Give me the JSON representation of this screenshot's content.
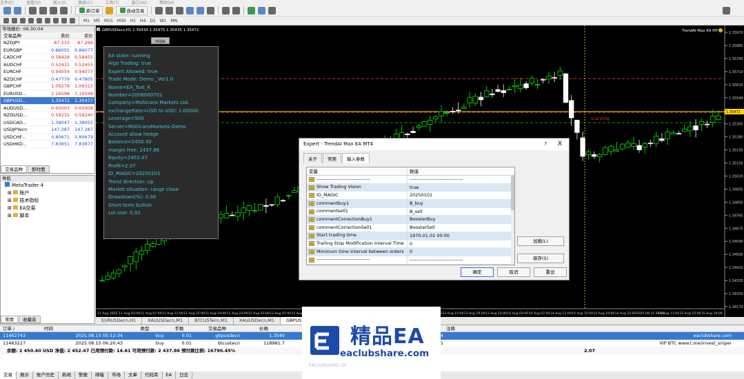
{
  "menu": [
    "文件(F)",
    "查看(V)",
    "插入(I)",
    "图表(C)",
    "工具(T)",
    "窗口(W)",
    "帮助(H)"
  ],
  "toolbar": {
    "new_order": "新订单",
    "auto_trading": "自动交易"
  },
  "timeframes": [
    "M1",
    "M5",
    "M15",
    "M30",
    "H1",
    "H4",
    "D1",
    "W1",
    "MN"
  ],
  "market_watch": {
    "title": "市场报价: 06:30:04",
    "cols": [
      "交易品种",
      "卖价",
      "买价"
    ],
    "rows": [
      {
        "sym": "NZDJPY",
        "bid": "87.233",
        "ask": "87.266",
        "dir": "dn",
        "sel": false
      },
      {
        "sym": "EURGBP",
        "bid": "0.86055",
        "ask": "0.86077",
        "dir": "up",
        "sel": false
      },
      {
        "sym": "CADCHF",
        "bid": "0.58428",
        "ask": "0.58455",
        "dir": "dn",
        "sel": false
      },
      {
        "sym": "AUDCHF",
        "bid": "0.52431",
        "ask": "0.52455",
        "dir": "dn",
        "sel": false
      },
      {
        "sym": "EURCHF",
        "bid": "0.94054",
        "ask": "0.94077",
        "dir": "dn",
        "sel": false
      },
      {
        "sym": "NZDCHF",
        "bid": "0.47779",
        "ask": "0.47805",
        "dir": "up",
        "sel": false
      },
      {
        "sym": "GBPCHF",
        "bid": "1.09278",
        "ask": "1.09315",
        "dir": "dn",
        "sel": false
      },
      {
        "sym": "EURUSD...",
        "bid": "1.16598",
        "ask": "1.16598",
        "dir": "dn",
        "sel": false
      },
      {
        "sym": "GBPUSD...",
        "bid": "1.35472",
        "ask": "1.35477",
        "dir": "up",
        "sel": true
      },
      {
        "sym": "AUDUSD...",
        "bid": "0.65003",
        "ask": "0.65008",
        "dir": "dn",
        "sel": false
      },
      {
        "sym": "NZDUSD...",
        "bid": "0.59235",
        "ask": "0.59240",
        "dir": "dn",
        "sel": false
      },
      {
        "sym": "USDCAD...",
        "bid": "1.38047",
        "ask": "1.38055",
        "dir": "up",
        "sel": false
      },
      {
        "sym": "USDJPYecn",
        "bid": "147.287",
        "ask": "147.287",
        "dir": "up",
        "sel": false
      },
      {
        "sym": "USDCHF...",
        "bid": "0.80671",
        "ask": "0.80679",
        "dir": "up",
        "sel": false
      },
      {
        "sym": "USDHKD...",
        "bid": "7.83851",
        "ask": "7.83877",
        "dir": "up",
        "sel": false
      }
    ],
    "tabs": [
      "交易品种",
      "即时图"
    ]
  },
  "navigator": {
    "title": "导航",
    "root": "MetaTrader 4",
    "items": [
      "账户",
      "技术指标",
      "EA交易",
      "脚本"
    ],
    "tabs": [
      "常用",
      "收藏夹"
    ]
  },
  "chart": {
    "header": "GBPUSDecn,H1  1.35439 1.35475 1.35435 1.35472",
    "ea_name": "TrendAI Max EA MT4",
    "price_label": "1.35472",
    "scanning": "scanning",
    "hide_label": "Hide",
    "prices": [
      "1.35970",
      "1.35885",
      "1.35795",
      "1.35710",
      "1.35625",
      "1.35540",
      "1.35455",
      "1.35365",
      "1.35280",
      "1.35195",
      "1.35105",
      "1.35020",
      "1.34935",
      "1.34850",
      "1.34765",
      "1.34675",
      "1.34590",
      "1.34505",
      "1.34420",
      "1.34335",
      "1.34250",
      "1.34170"
    ],
    "times": [
      "11 Aug 2025",
      "11 Aug 03:00",
      "11 Aug 07:00",
      "11 Aug 11:00",
      "11 Aug 15:00",
      "11 Aug 19:00",
      "11 Aug 23:00",
      "12 Aug 03:00",
      "12 Aug 07:00",
      "12 Aug 11:00",
      "12 Aug 15:00",
      "12 Aug 19:00",
      "12 Aug 23:00",
      "13 Aug 03:00",
      "13 Aug 07:00",
      "13 Aug 11:00",
      "13 Aug 15:00",
      "13 Aug 19:00",
      "13 Aug 23:00",
      "14 Aug 03:00",
      "14 Aug 07:00",
      "14 Aug 11:00",
      "14 Aug 15:00",
      "14 Aug 19:00",
      "14 Aug 23:00",
      "2025.08.15 06:00",
      "15 Aug 11:00",
      "15 Aug 15:00",
      "15 Aug 19:00"
    ],
    "colors": {
      "bull": "#00ff00",
      "bear": "#ffffff",
      "bid_line": "#ffd700",
      "level_line": "#d03030",
      "green_line": "#00a000"
    }
  },
  "info_panel": [
    "EA state: running",
    "Algo Trading: true",
    "Expert Allowed: true",
    "Trade Mode: Demo _Ver1.0",
    "Name=EA_Tsxt_K",
    "Number=2006000701",
    "Company=Mohicans Markets Ltd.",
    "exchangeRate=USD to USD: 1.00000",
    "Leverage=500",
    "Server=MohicansMarkets-Demo",
    "Account allow hedge",
    "Balance=2450.40",
    "margin free: 2437.86",
    "Equity=2452.47",
    "Profit=2.07",
    "ID_MAGIC=20250101",
    "Trend direction: up",
    "Market situation: range close",
    "Drawdown(%): 0.00",
    "Short-term bullish",
    "Lot size: 0.02"
  ],
  "chart_tabs": [
    "EURUSDecn,H1",
    "XAUUSDecn,M1",
    "BTCUSTecn,M1",
    "XAUUSDecn,M1",
    "GBPUSDec"
  ],
  "dialog": {
    "title": "Expert - TrendAI Max EA MT4",
    "help": "?",
    "close": "X",
    "tabs": [
      "关于",
      "常用",
      "输入参数"
    ],
    "grid_cols": [
      "变量",
      "数值"
    ],
    "params": [
      {
        "name": "---------------------------------",
        "value": "---------------------------------",
        "hl": false
      },
      {
        "name": "Show Trading Vision",
        "value": "true",
        "hl": true
      },
      {
        "name": "ID_MAGIC",
        "value": "20250101",
        "hl": false
      },
      {
        "name": "commentbuy1",
        "value": "B_buy",
        "hl": true
      },
      {
        "name": "commentsell1",
        "value": "B_sell",
        "hl": false
      },
      {
        "name": "commentCorrectionBuy1",
        "value": "BoosterBuy",
        "hl": true
      },
      {
        "name": "commentCorrectionSell1",
        "value": "BoosterSell",
        "hl": false
      },
      {
        "name": "Start trading time",
        "value": "1970.01.01 00:00",
        "hl": true
      },
      {
        "name": "Trailing Stop Modification Interval Time",
        "value": "0",
        "hl": false
      },
      {
        "name": "Minimum time interval between orders",
        "value": "0",
        "hl": true
      },
      {
        "name": "---------------------------------",
        "value": "---------------------------------",
        "hl": false
      }
    ],
    "load": "加载(L)",
    "save": "保存(S)",
    "ok": "确定",
    "cancel": "取消",
    "reset": "重设"
  },
  "terminal": {
    "cols": [
      "订单 /",
      "时间",
      "类型",
      "手数",
      "交易品种",
      "价格",
      "手续费",
      "库存费",
      "获利",
      "注释"
    ],
    "orders": [
      {
        "id": "11462743",
        "time": "2025.08.15 05:12:34",
        "type": "buy",
        "lots": "0.01",
        "sym": "gbpusdecn",
        "price": "1.3540",
        "comm": "-0.06",
        "swap": "0.00",
        "profit": "0.64",
        "note": "eaclubshare.com",
        "sel": true
      },
      {
        "id": "11463227",
        "time": "2025.08.15 06:20:43",
        "type": "buy",
        "lots": "0.01",
        "sym": "btcustecn",
        "price": "118981.7",
        "comm": "0.00",
        "swap": "0.00",
        "profit": "1.51",
        "note": "VIP BTC www.t.me/invest_sniper",
        "sel": false
      }
    ],
    "summary": "余额: 2 450.40 USD  净值: 2 452.47  已用预付款: 14.61  可用预付款: 2 437.86  预付款比例: 16790.45%",
    "summary_profit": "2.07"
  },
  "bottom_tabs": [
    "交易",
    "展示",
    "账户历史",
    "新闻",
    "警报",
    "邮箱",
    "市场",
    "文章",
    "代码库",
    "EA",
    "日志"
  ],
  "watermark": {
    "title": "精品EA",
    "url": "eaclubshare.com",
    "cn": "EACLUBSHARE.CN"
  }
}
